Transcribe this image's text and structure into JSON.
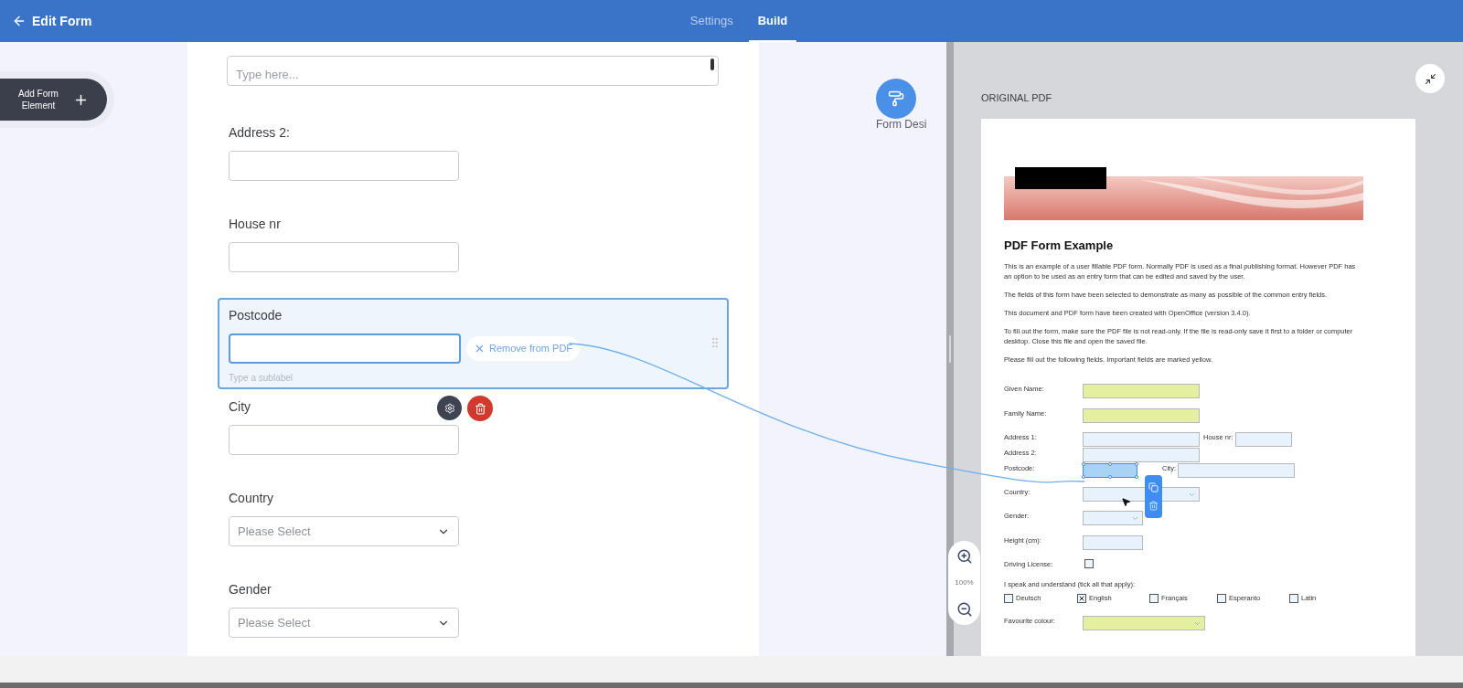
{
  "header": {
    "title": "Edit Form",
    "tabs": [
      {
        "label": "Settings",
        "selected": false
      },
      {
        "label": "Build",
        "selected": true
      }
    ]
  },
  "add_element": {
    "label": "Add Form Element"
  },
  "form": {
    "fields": [
      {
        "kind": "textarea",
        "placeholder": "Type here...",
        "selected": false
      },
      {
        "kind": "text",
        "label": "Address 2:",
        "selected": false
      },
      {
        "kind": "text",
        "label": "House nr",
        "selected": false
      },
      {
        "kind": "text",
        "label": "Postcode",
        "selected": true,
        "sublabel_placeholder": "Type a sublabel",
        "remove_label": "Remove from PDF"
      },
      {
        "kind": "text",
        "label": "City",
        "selected": false
      },
      {
        "kind": "select",
        "label": "Country",
        "placeholder": "Please Select",
        "selected": false
      },
      {
        "kind": "select",
        "label": "Gender",
        "placeholder": "Please Select",
        "selected": false
      }
    ]
  },
  "form_designer": {
    "label": "Form Desi"
  },
  "pdf_panel": {
    "title": "ORIGINAL PDF",
    "zoom_level": "100%",
    "document": {
      "heading": "PDF Form Example",
      "paragraphs": [
        "This is an example of a user fillable PDF form. Normally PDF is used as a final publishing format. However PDF has an option to be used as an entry form that can be edited and saved by the user.",
        "The fields of this form have been selected to demonstrate as many as possible of the common entry fields.",
        "This document and PDF form have been created with OpenOffice (version 3.4.0).",
        "To fill out the form, make sure the PDF file is not read-only. If the file is read-only save it first to a folder or computer desktop. Close this file and open the saved file.",
        "Please fill out the following fields. Important fields are marked yellow."
      ],
      "rows": [
        {
          "kind": "fields",
          "items": [
            {
              "label": "Given Name:",
              "kind": "text",
              "required": true,
              "selected": false
            }
          ]
        },
        {
          "kind": "fields",
          "items": [
            {
              "label": "Family Name:",
              "kind": "text",
              "required": true,
              "selected": false
            }
          ]
        },
        {
          "kind": "fields",
          "items": [
            {
              "label": "Address 1:",
              "kind": "text",
              "required": false,
              "selected": false
            },
            {
              "label": "House nr:",
              "kind": "text",
              "required": false,
              "selected": false
            }
          ]
        },
        {
          "kind": "fields",
          "items": [
            {
              "label": "Address 2:",
              "kind": "text",
              "required": false,
              "selected": false
            }
          ]
        },
        {
          "kind": "fields",
          "items": [
            {
              "label": "Postcode:",
              "kind": "text",
              "required": false,
              "selected": true
            },
            {
              "label": "City:",
              "kind": "text",
              "required": false,
              "selected": false
            }
          ]
        },
        {
          "kind": "fields",
          "items": [
            {
              "label": "Country:",
              "kind": "select",
              "required": false,
              "selected": false
            }
          ]
        },
        {
          "kind": "fields",
          "items": [
            {
              "label": "Gender:",
              "kind": "select",
              "required": false,
              "selected": false
            }
          ]
        },
        {
          "kind": "fields",
          "items": [
            {
              "label": "Height (cm):",
              "kind": "text",
              "required": false,
              "selected": false
            }
          ]
        },
        {
          "kind": "fields",
          "items": [
            {
              "label": "Driving License:",
              "kind": "checkbox",
              "checked": false
            }
          ]
        },
        {
          "kind": "checkgroup",
          "prompt": "I speak and understand (tick all that apply):",
          "options": [
            {
              "label": "Deutsch",
              "checked": false
            },
            {
              "label": "English",
              "checked": true
            },
            {
              "label": "Français",
              "checked": false
            },
            {
              "label": "Esperanto",
              "checked": false
            },
            {
              "label": "Latin",
              "checked": false
            }
          ]
        },
        {
          "kind": "fields",
          "items": [
            {
              "label": "Favourite colour:",
              "kind": "select",
              "required": true,
              "selected": false
            }
          ]
        }
      ]
    }
  }
}
